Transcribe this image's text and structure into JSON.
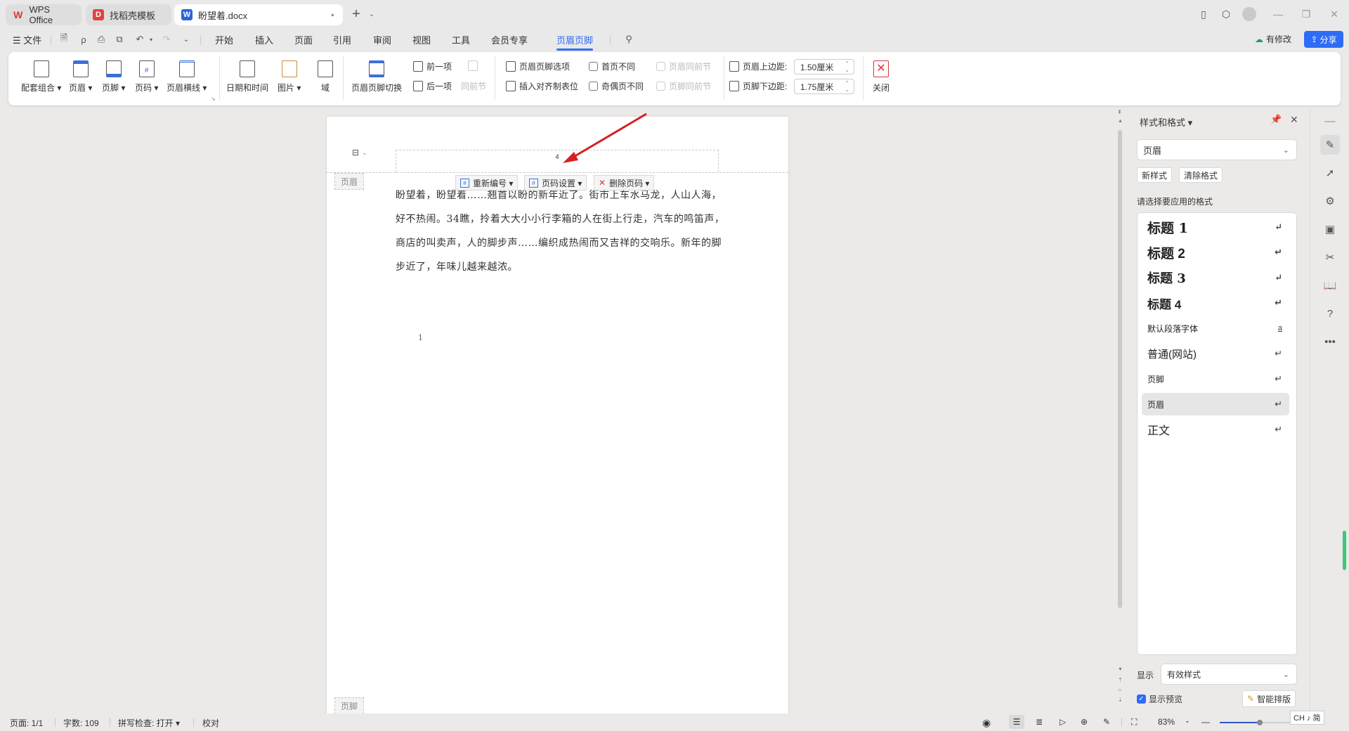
{
  "tabs": [
    {
      "label": "WPS Office",
      "icon": "wps-logo-icon",
      "active": false
    },
    {
      "label": "找稻壳模板",
      "icon": "docer-icon",
      "active": false
    },
    {
      "label": "盼望着.docx",
      "icon": "word-doc-icon",
      "active": true,
      "unsaved_dot": "●"
    }
  ],
  "new_tab": "+",
  "window_controls": {
    "minimize": "—",
    "restore": "❐",
    "close": "✕"
  },
  "menu": {
    "file": "文件",
    "items": [
      "开始",
      "插入",
      "页面",
      "引用",
      "审阅",
      "视图",
      "工具",
      "会员专享",
      "页眉页脚"
    ],
    "active": "页眉页脚",
    "modified": "有修改",
    "share": "分享"
  },
  "ribbon": {
    "group1": [
      {
        "label": "配套组合 ▾",
        "icon": "combo-icon"
      },
      {
        "label": "页眉 ▾",
        "icon": "header-icon"
      },
      {
        "label": "页脚 ▾",
        "icon": "footer-icon"
      },
      {
        "label": "页码 ▾",
        "icon": "page-number-icon"
      },
      {
        "label": "页眉横线 ▾",
        "icon": "header-line-icon"
      }
    ],
    "group2": [
      {
        "label": "日期和时间",
        "icon": "date-time-icon"
      },
      {
        "label": "图片 ▾",
        "icon": "picture-icon"
      },
      {
        "label": "域",
        "icon": "field-icon"
      }
    ],
    "switch": "页眉页脚切换",
    "prev": "前一项",
    "next": "后一项",
    "same_as_prev": "同前节",
    "options": "页眉页脚选项",
    "insert_tab": "插入对齐制表位",
    "first_page_diff": "首页不同",
    "odd_even_diff": "奇偶页不同",
    "header_same_prev": "页眉同前节",
    "footer_same_prev": "页脚同前节",
    "header_top_label": "页眉上边距:",
    "header_top_value": "1.50厘米",
    "footer_bottom_label": "页脚下边距:",
    "footer_bottom_value": "1.75厘米",
    "close": "关闭"
  },
  "document": {
    "header_page_number": "4",
    "header_tag": "页眉",
    "footer_tag": "页脚",
    "float_buttons": [
      "重新编号 ▾",
      "页码设置 ▾",
      "删除页码 ▾"
    ],
    "paragraph": "盼望着，盼望着……翘首以盼的新年近了。街市上车水马龙，人山人海，好不热闹。34瞧，拎着大大小小行李箱的人在街上行走，汽车的鸣笛声，商店的叫卖声，人的脚步声……编织成热闹而又吉祥的交响乐。新年的脚步近了，年味儿越来越浓。",
    "page_marker": "1"
  },
  "panel": {
    "title": "样式和格式 ▾",
    "current_style": "页眉",
    "new_style": "新样式",
    "clear_format": "清除格式",
    "prompt": "请选择要应用的格式",
    "styles": [
      {
        "label": "标题  1",
        "mark": "↵"
      },
      {
        "label": "标题  2",
        "mark": "↵"
      },
      {
        "label": "标题  3",
        "mark": "↵"
      },
      {
        "label": "标题 4",
        "mark": "↵"
      },
      {
        "label": "默认段落字体",
        "mark": "a"
      },
      {
        "label": "普通(网站)",
        "mark": "↵"
      },
      {
        "label": "页脚",
        "mark": "↵"
      },
      {
        "label": "页眉",
        "mark": "↵",
        "selected": true
      },
      {
        "label": "正文",
        "mark": "↵"
      }
    ],
    "show_label": "显示",
    "show_value": "有效样式",
    "show_preview": "显示预览",
    "show_preview_checked": true,
    "smart_layout": "智能排版"
  },
  "status": {
    "page": "页面: 1/1",
    "words": "字数: 109",
    "spell": "拼写检查: 打开 ▾",
    "proof": "校对",
    "zoom": "83%",
    "zoom_percent": 83,
    "ime": "CH ♪ 简"
  },
  "colors": {
    "accent": "#2f6cf5",
    "arrow": "#d42020",
    "close_red": "#d9363e"
  }
}
